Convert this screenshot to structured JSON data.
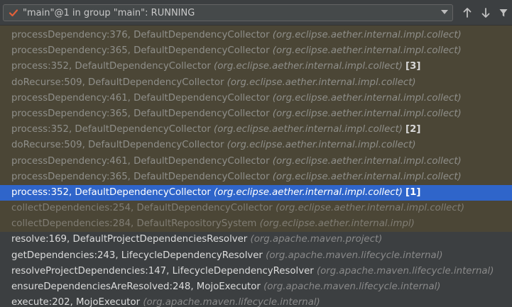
{
  "toolbar": {
    "thread_label": "\"main\"@1 in group \"main\": RUNNING",
    "status_icon": "check-icon",
    "up_icon": "arrow-up-icon",
    "down_icon": "arrow-down-icon",
    "filter_icon": "filter-icon"
  },
  "frames": [
    {
      "method": "processDependency:376, DefaultDependencyCollector",
      "pkg": "(org.eclipse.aether.internal.impl.collect)",
      "depth": "",
      "kind": "lib"
    },
    {
      "method": "processDependency:365, DefaultDependencyCollector",
      "pkg": "(org.eclipse.aether.internal.impl.collect)",
      "depth": "",
      "kind": "lib"
    },
    {
      "method": "process:352, DefaultDependencyCollector",
      "pkg": "(org.eclipse.aether.internal.impl.collect)",
      "depth": "[3]",
      "kind": "lib"
    },
    {
      "method": "doRecurse:509, DefaultDependencyCollector",
      "pkg": "(org.eclipse.aether.internal.impl.collect)",
      "depth": "",
      "kind": "lib"
    },
    {
      "method": "processDependency:461, DefaultDependencyCollector",
      "pkg": "(org.eclipse.aether.internal.impl.collect)",
      "depth": "",
      "kind": "lib"
    },
    {
      "method": "processDependency:365, DefaultDependencyCollector",
      "pkg": "(org.eclipse.aether.internal.impl.collect)",
      "depth": "",
      "kind": "lib"
    },
    {
      "method": "process:352, DefaultDependencyCollector",
      "pkg": "(org.eclipse.aether.internal.impl.collect)",
      "depth": "[2]",
      "kind": "lib"
    },
    {
      "method": "doRecurse:509, DefaultDependencyCollector",
      "pkg": "(org.eclipse.aether.internal.impl.collect)",
      "depth": "",
      "kind": "lib"
    },
    {
      "method": "processDependency:461, DefaultDependencyCollector",
      "pkg": "(org.eclipse.aether.internal.impl.collect)",
      "depth": "",
      "kind": "lib"
    },
    {
      "method": "processDependency:365, DefaultDependencyCollector",
      "pkg": "(org.eclipse.aether.internal.impl.collect)",
      "depth": "",
      "kind": "lib"
    },
    {
      "method": "process:352, DefaultDependencyCollector",
      "pkg": "(org.eclipse.aether.internal.impl.collect)",
      "depth": "[1]",
      "kind": "selected"
    },
    {
      "method": "collectDependencies:254, DefaultDependencyCollector",
      "pkg": "(org.eclipse.aether.internal.impl.collect)",
      "depth": "",
      "kind": "lib dim"
    },
    {
      "method": "collectDependencies:284, DefaultRepositorySystem",
      "pkg": "(org.eclipse.aether.internal.impl)",
      "depth": "",
      "kind": "lib dim"
    },
    {
      "method": "resolve:169, DefaultProjectDependenciesResolver",
      "pkg": "(org.apache.maven.project)",
      "depth": "",
      "kind": "user"
    },
    {
      "method": "getDependencies:243, LifecycleDependencyResolver",
      "pkg": "(org.apache.maven.lifecycle.internal)",
      "depth": "",
      "kind": "user"
    },
    {
      "method": "resolveProjectDependencies:147, LifecycleDependencyResolver",
      "pkg": "(org.apache.maven.lifecycle.internal)",
      "depth": "",
      "kind": "user"
    },
    {
      "method": "ensureDependenciesAreResolved:248, MojoExecutor",
      "pkg": "(org.apache.maven.lifecycle.internal)",
      "depth": "",
      "kind": "user"
    },
    {
      "method": "execute:202, MojoExecutor",
      "pkg": "(org.apache.maven.lifecycle.internal)",
      "depth": "",
      "kind": "user"
    }
  ]
}
